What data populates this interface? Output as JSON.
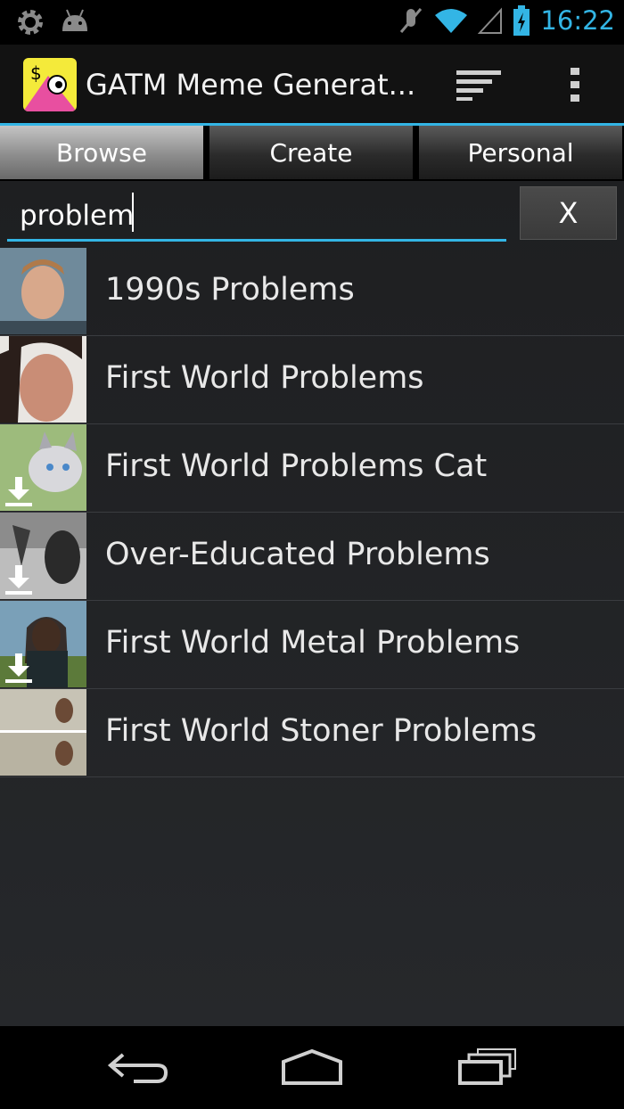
{
  "status_bar": {
    "time": "16:22",
    "icons": [
      "settings-icon",
      "android-icon",
      "mute-icon",
      "wifi-icon",
      "signal-icon",
      "battery-charging-icon"
    ]
  },
  "action_bar": {
    "title": "GATM Meme Generat...",
    "app_icon": "app-logo-icon",
    "actions": [
      "sort-icon",
      "overflow-menu-icon"
    ]
  },
  "tabs": [
    {
      "label": "Browse",
      "active": true
    },
    {
      "label": "Create",
      "active": false
    },
    {
      "label": "Personal",
      "active": false
    }
  ],
  "search": {
    "value": "problem",
    "clear_label": "X"
  },
  "results": [
    {
      "label": "1990s Problems",
      "downloadable": false
    },
    {
      "label": "First World Problems",
      "downloadable": false
    },
    {
      "label": "First World Problems Cat",
      "downloadable": true
    },
    {
      "label": "Over-Educated Problems",
      "downloadable": true
    },
    {
      "label": "First World Metal Problems",
      "downloadable": true
    },
    {
      "label": "First World Stoner Problems",
      "downloadable": false
    }
  ],
  "nav_bar": [
    "back-icon",
    "home-icon",
    "recent-apps-icon"
  ],
  "colors": {
    "accent": "#33b5e5",
    "background": "#1e1f21"
  }
}
